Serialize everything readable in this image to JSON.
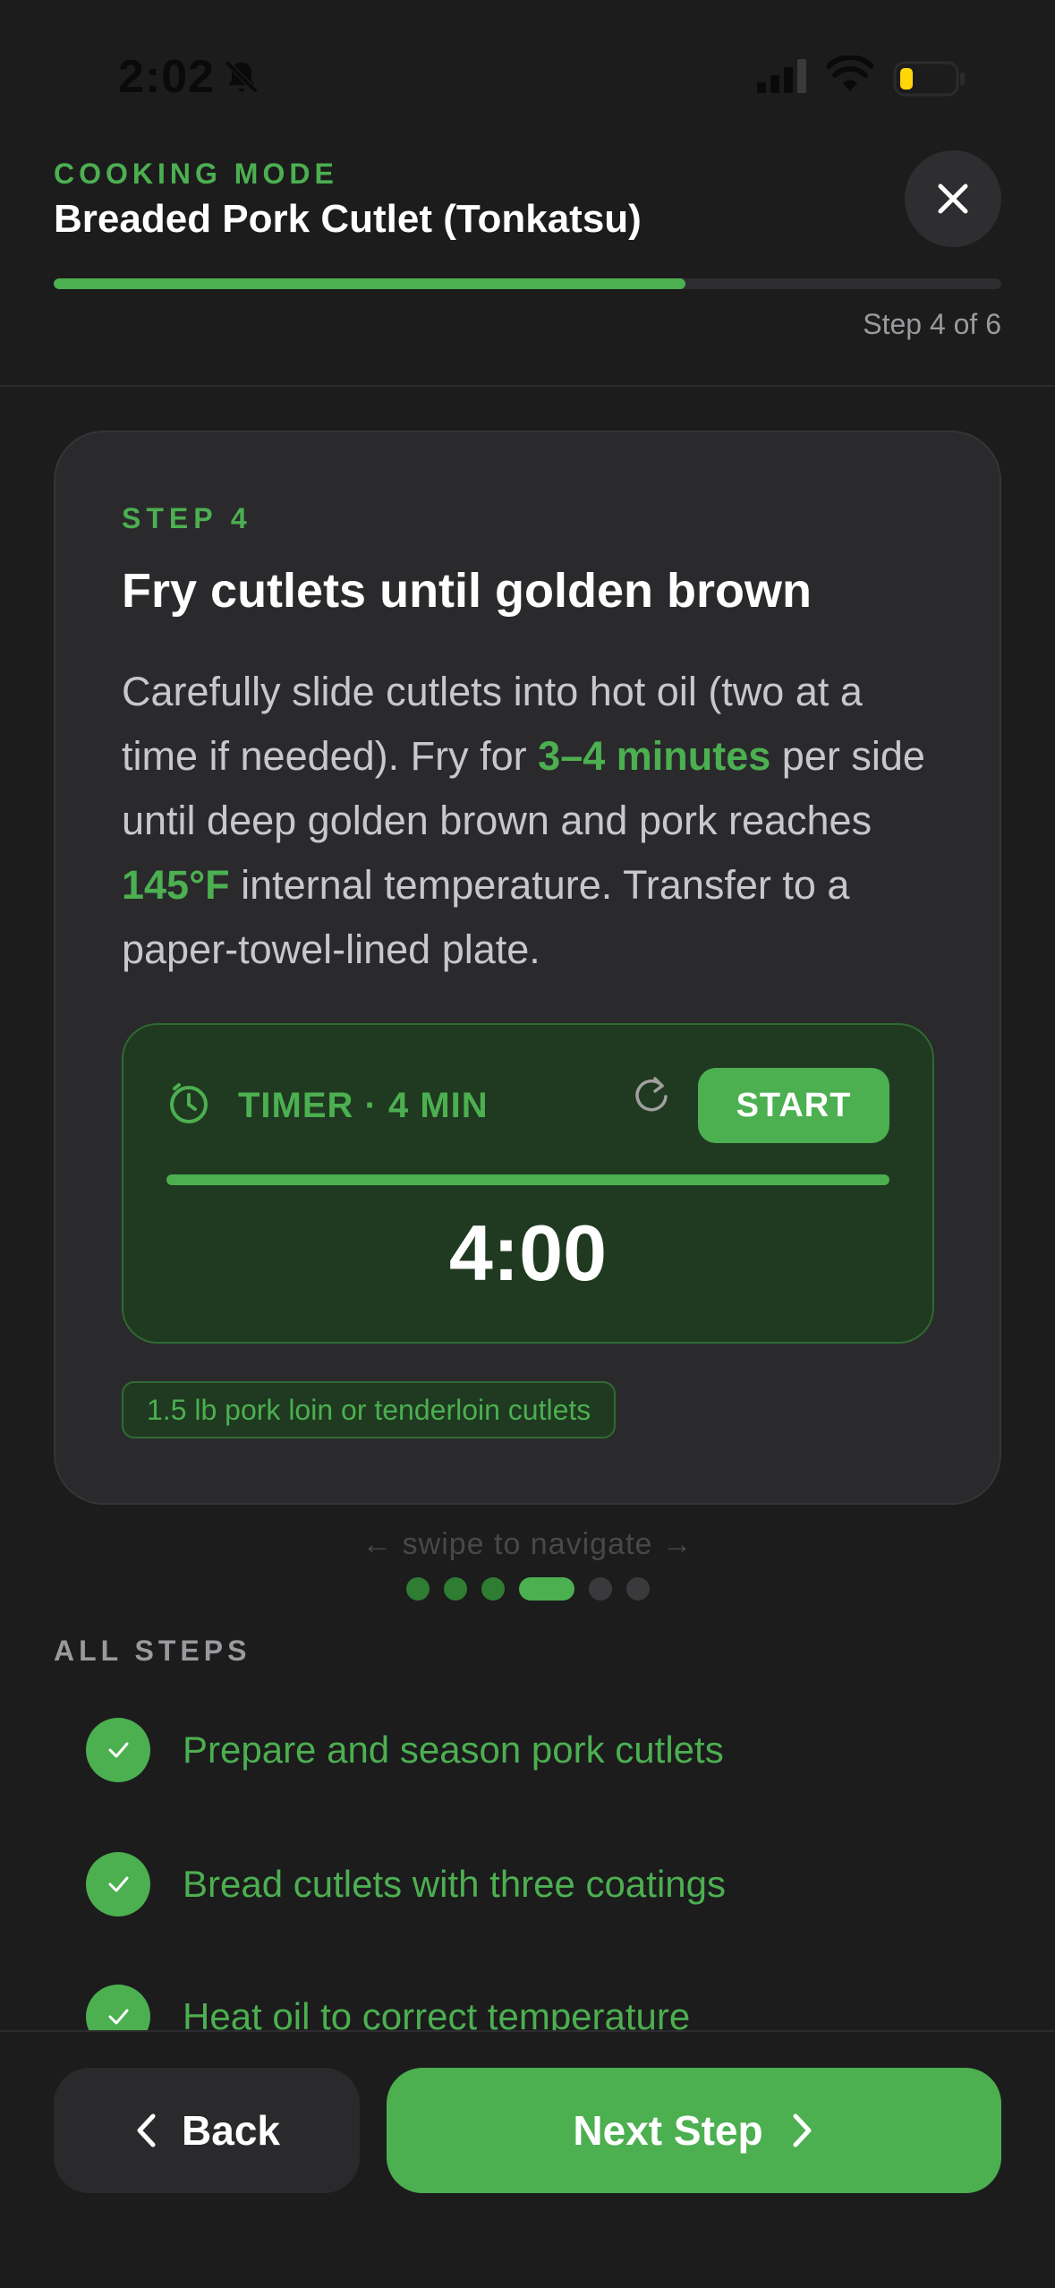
{
  "status_bar": {
    "time": "2:02"
  },
  "header": {
    "mode_label": "COOKING MODE",
    "recipe_title": "Breaded Pork Cutlet (Tonkatsu)",
    "progress": 0.667,
    "step_count": "Step 4 of 6"
  },
  "step": {
    "label": "STEP 4",
    "title": "Fry cutlets until golden brown",
    "desc_part1": "Carefully slide cutlets into hot oil (two at a time if needed). Fry for ",
    "desc_hl1": "3–4 minutes",
    "desc_part2": " per side until deep golden brown and pork reaches ",
    "desc_hl2": "145°F",
    "desc_part3": " internal temperature. Transfer to a paper-towel-lined plate.",
    "timer": {
      "label": "TIMER · 4 MIN",
      "start_label": "START",
      "display": "4:00",
      "remaining_fraction": 1.0
    },
    "ingredient": "1.5 lb pork loin or tenderloin cutlets"
  },
  "swipe_hint": "← swipe to navigate →",
  "pager": {
    "total": 6,
    "current": 4
  },
  "all_steps": {
    "label": "ALL STEPS",
    "items": [
      {
        "text": "Prepare and season pork cutlets"
      },
      {
        "text": "Bread cutlets with three coatings"
      },
      {
        "text": "Heat oil to correct temperature"
      }
    ]
  },
  "nav": {
    "back_label": "Back",
    "next_label": "Next Step"
  },
  "colors": {
    "accent": "#4caf50",
    "background": "#1c1c1d",
    "card": "#2a2a2c"
  }
}
